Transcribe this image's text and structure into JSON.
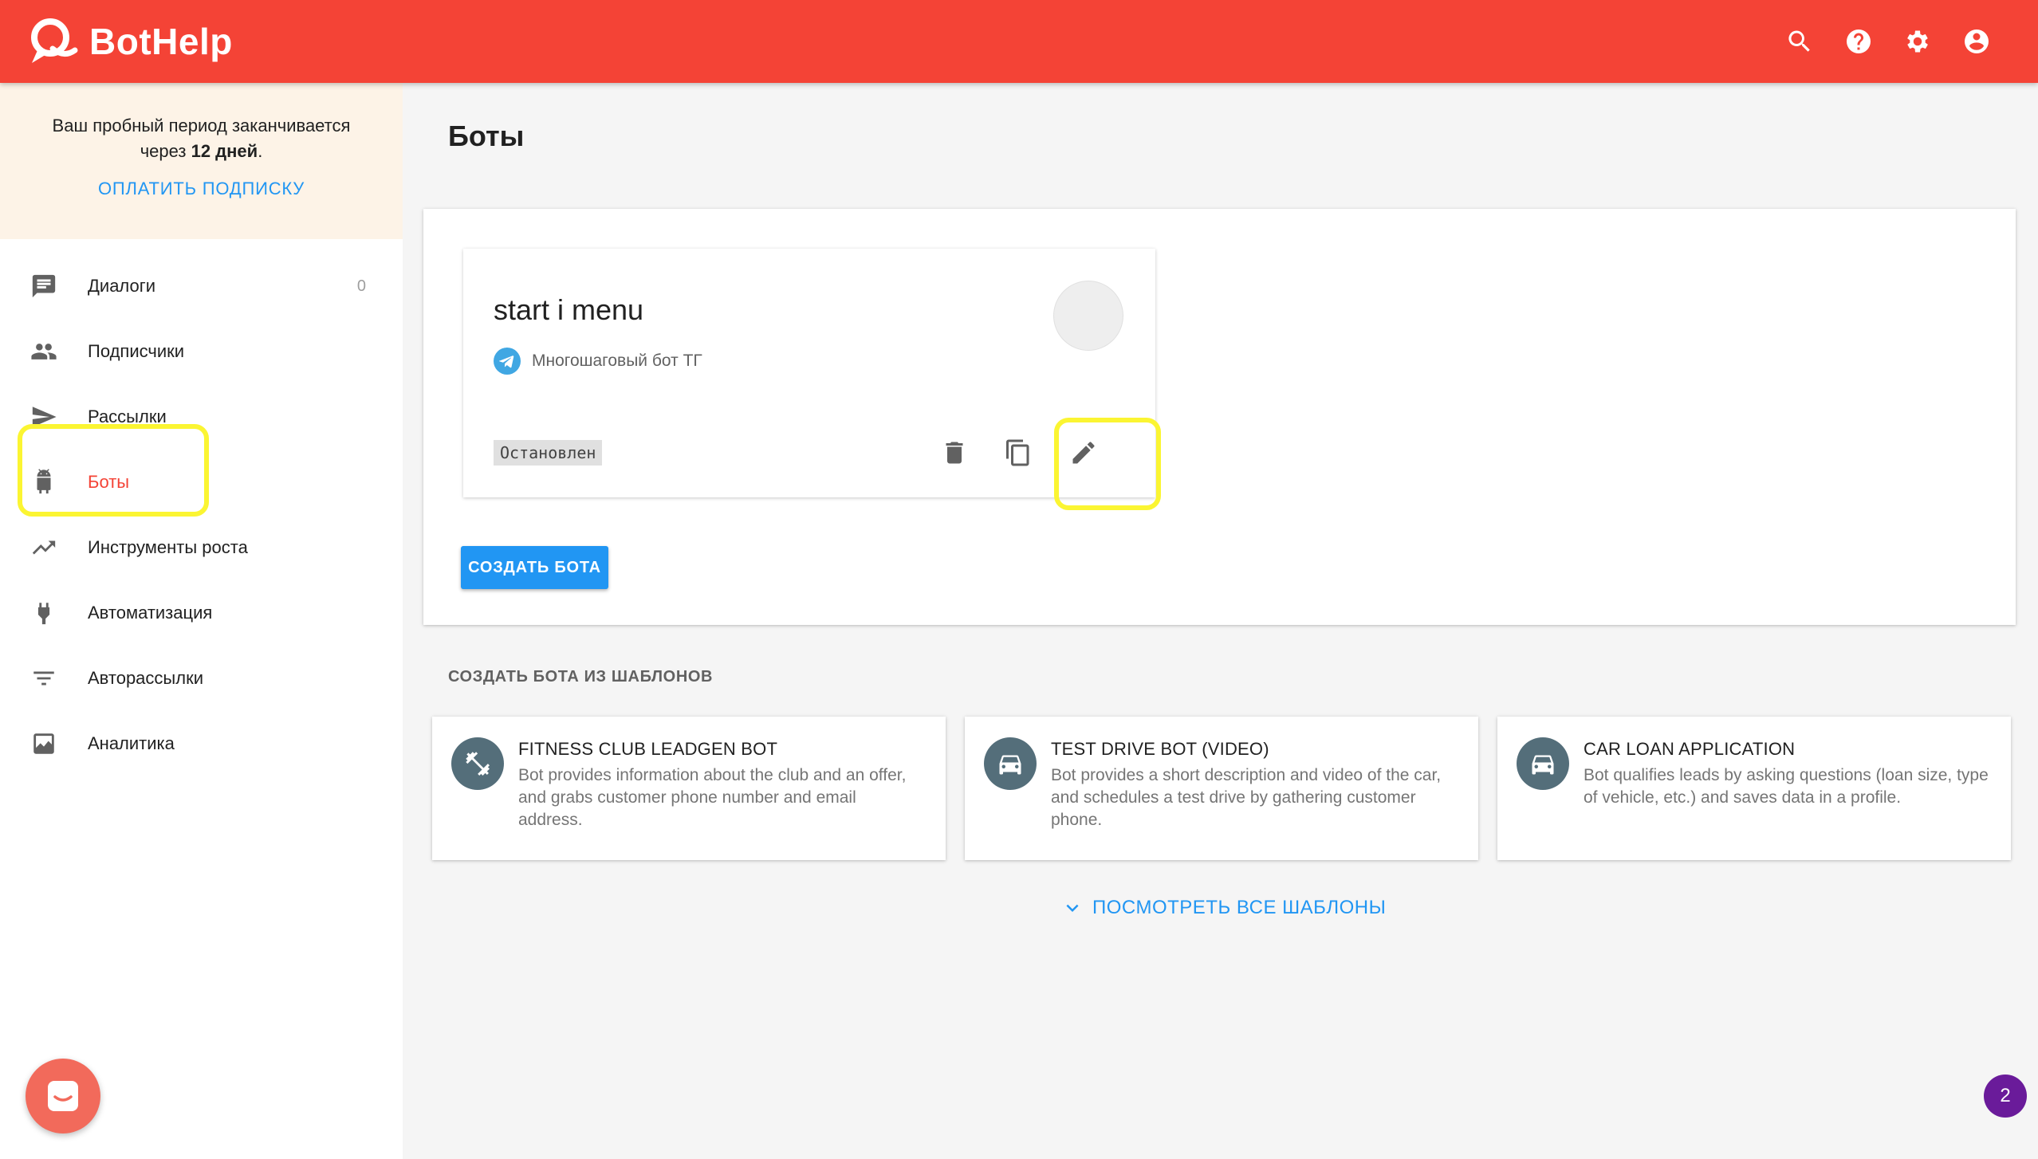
{
  "header": {
    "logo_text": "BotHelp",
    "icons": [
      "search-icon",
      "help-icon",
      "settings-icon",
      "account-icon"
    ]
  },
  "trial": {
    "line1": "Ваш пробный период заканчивается",
    "line2_prefix": "через ",
    "line2_bold": "12 дней",
    "line2_suffix": ".",
    "pay_link": "ОПЛАТИТЬ ПОДПИСКУ"
  },
  "sidebar": {
    "items": [
      {
        "label": "Диалоги",
        "icon": "chat-icon",
        "count": "0"
      },
      {
        "label": "Подписчики",
        "icon": "people-icon"
      },
      {
        "label": "Рассылки",
        "icon": "send-icon"
      },
      {
        "label": "Боты",
        "icon": "android-icon",
        "active": true
      },
      {
        "label": "Инструменты роста",
        "icon": "trending-up-icon"
      },
      {
        "label": "Автоматизация",
        "icon": "plug-icon"
      },
      {
        "label": "Авторассылки",
        "icon": "filter-icon"
      },
      {
        "label": "Аналитика",
        "icon": "analytics-icon"
      }
    ],
    "active_color": "#f44336"
  },
  "main": {
    "title": "Боты",
    "bot": {
      "name": "start i menu",
      "type": "Многошаговый бот ТГ",
      "status": "Остановлен"
    },
    "create_button": "СОЗДАТЬ БОТА",
    "templates_heading": "СОЗДАТЬ БОТА ИЗ ШАБЛОНОВ",
    "templates": [
      {
        "title": "FITNESS CLUB LEADGEN BOT",
        "desc": "Bot provides information about the club and an offer, and grabs customer phone number and email address.",
        "icon": "fitness-icon"
      },
      {
        "title": "TEST DRIVE BOT (VIDEO)",
        "desc": "Bot provides a short description and video of the car, and schedules a test drive by gathering customer phone.",
        "icon": "car-icon"
      },
      {
        "title": "CAR LOAN APPLICATION",
        "desc": "Bot qualifies leads by asking questions (loan size, type of vehicle, etc.) and saves data in a profile.",
        "icon": "car-icon"
      }
    ],
    "view_all": "ПОСМОТРЕТЬ ВСЕ ШАБЛОНЫ"
  },
  "notification_count": "2",
  "colors": {
    "header": "#f44336",
    "accent": "#2196f3",
    "highlight": "#fbf532"
  }
}
